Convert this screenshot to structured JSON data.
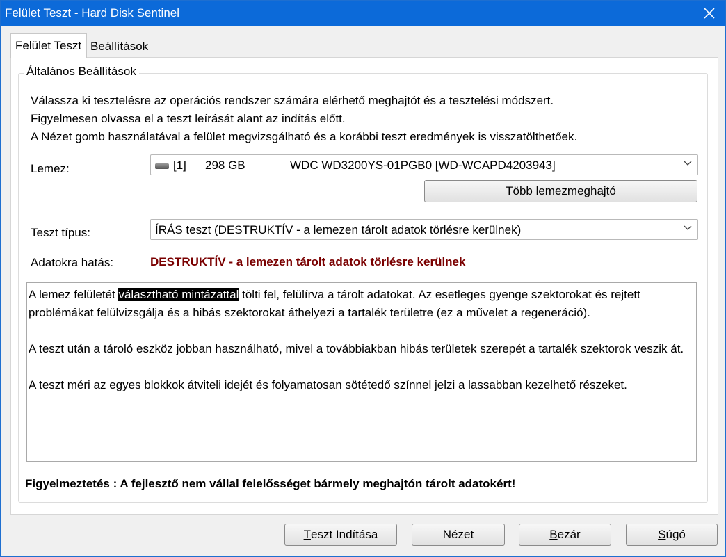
{
  "window": {
    "title": "Felület Teszt - Hard Disk Sentinel"
  },
  "tabs": [
    "Felület Teszt",
    "Beállítások"
  ],
  "group": {
    "label": "Általános Beállítások",
    "intro": [
      "Válassza ki tesztelésre az operációs rendszer számára elérhető meghajtót és a tesztelési módszert.",
      "Figyelmesen olvassa el a teszt leírását alant az indítás előtt.",
      "A Nézet gomb használatával a felület megvizsgálható és a korábbi teszt eredmények is visszatölthetőek."
    ]
  },
  "disk": {
    "label": "Lemez:",
    "index": "[1]",
    "size": "298 GB",
    "model": "WDC WD3200YS-01PGB0 [WD-WCAPD4203943]",
    "icon": "drive-icon",
    "more_button": "Több lemezmeghajtó"
  },
  "test_type": {
    "label": "Teszt típus:",
    "value": "ÍRÁS teszt (DESTRUKTÍV - a lemezen tárolt adatok törlésre kerülnek)"
  },
  "impact": {
    "label": "Adatokra hatás:",
    "value": "DESTRUKTÍV - a lemezen tárolt adatok törlésre kerülnek",
    "color": "#7a0000"
  },
  "description": {
    "p1_before": "A lemez felületét ",
    "p1_highlight": "választható mintázattal",
    "p1_after": " tölti fel, felülírva a tárolt adatokat. Az esetleges gyenge szektorokat és rejtett problémákat felülvizsgálja és a hibás szektorokat áthelyezi a tartalék területre (ez a művelet a regeneráció).",
    "p2": "A teszt után a tároló eszköz jobban használható, mivel a továbbiakban hibás területek szerepét a tartalék szektorok veszik át.",
    "p3": "A teszt méri az egyes blokkok átviteli idejét és folyamatosan sötétedő színnel jelzi a lassabban kezelhető részeket."
  },
  "warning": "Figyelmeztetés : A fejlesztő nem vállal felelősséget bármely meghajtón tárolt adatokért!",
  "buttons": {
    "start_first": "T",
    "start_rest": "eszt Indítása",
    "view": "Nézet",
    "close_first": "B",
    "close_rest": "ezár",
    "help_first": "S",
    "help_rest": "úgó"
  },
  "colors": {
    "titlebar": "#0c6ad9",
    "accent_border": "#1e6fd0"
  }
}
